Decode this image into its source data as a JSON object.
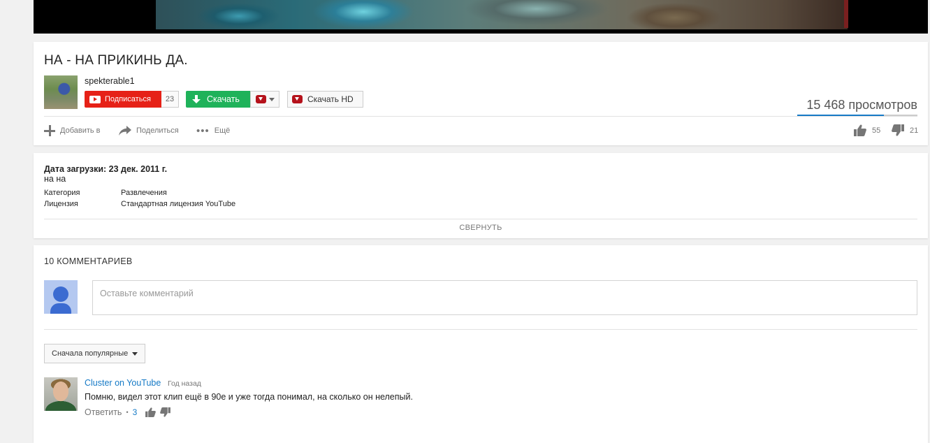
{
  "video": {
    "title": "НА - НА ПРИКИНЬ ДА."
  },
  "channel": {
    "name": "spekterable1",
    "subscribe_label": "Подписаться",
    "subscriber_count": "23"
  },
  "download": {
    "label": "Скачать",
    "hd_label": "Скачать HD"
  },
  "stats": {
    "views": "15 468 просмотров",
    "likes": "55",
    "dislikes": "21",
    "like_ratio": 0.72
  },
  "actions": {
    "add_to": "Добавить в",
    "share": "Поделиться",
    "more": "Ещё"
  },
  "description": {
    "upload_date": "Дата загрузки: 23 дек. 2011 г.",
    "text": "на на",
    "meta": [
      {
        "label": "Категория",
        "value": "Развлечения"
      },
      {
        "label": "Лицензия",
        "value": "Стандартная лицензия YouTube"
      }
    ],
    "collapse_label": "СВЕРНУТЬ"
  },
  "comments": {
    "header": "10 КОММЕНТАРИЕВ",
    "input_placeholder": "Оставьте комментарий",
    "sort_label": "Сначала популярные",
    "items": [
      {
        "author": "Cluster on YouTube",
        "time": "Год назад",
        "text": "Помню, видел этот клип ещё в 90е и уже тогда понимал, на сколько он нелепый.",
        "reply_label": "Ответить",
        "separator": "•",
        "likes": "3"
      }
    ]
  },
  "colors": {
    "subscribe_red": "#e62117",
    "download_green": "#1fb25a",
    "link_blue": "#167ac6"
  },
  "icons": [
    "youtube-icon",
    "arrow-down-icon",
    "red-download-icon",
    "caret-down-icon",
    "plus-icon",
    "share-icon",
    "more-icon",
    "thumbs-up-icon",
    "thumbs-down-icon",
    "user-avatar-icon"
  ]
}
